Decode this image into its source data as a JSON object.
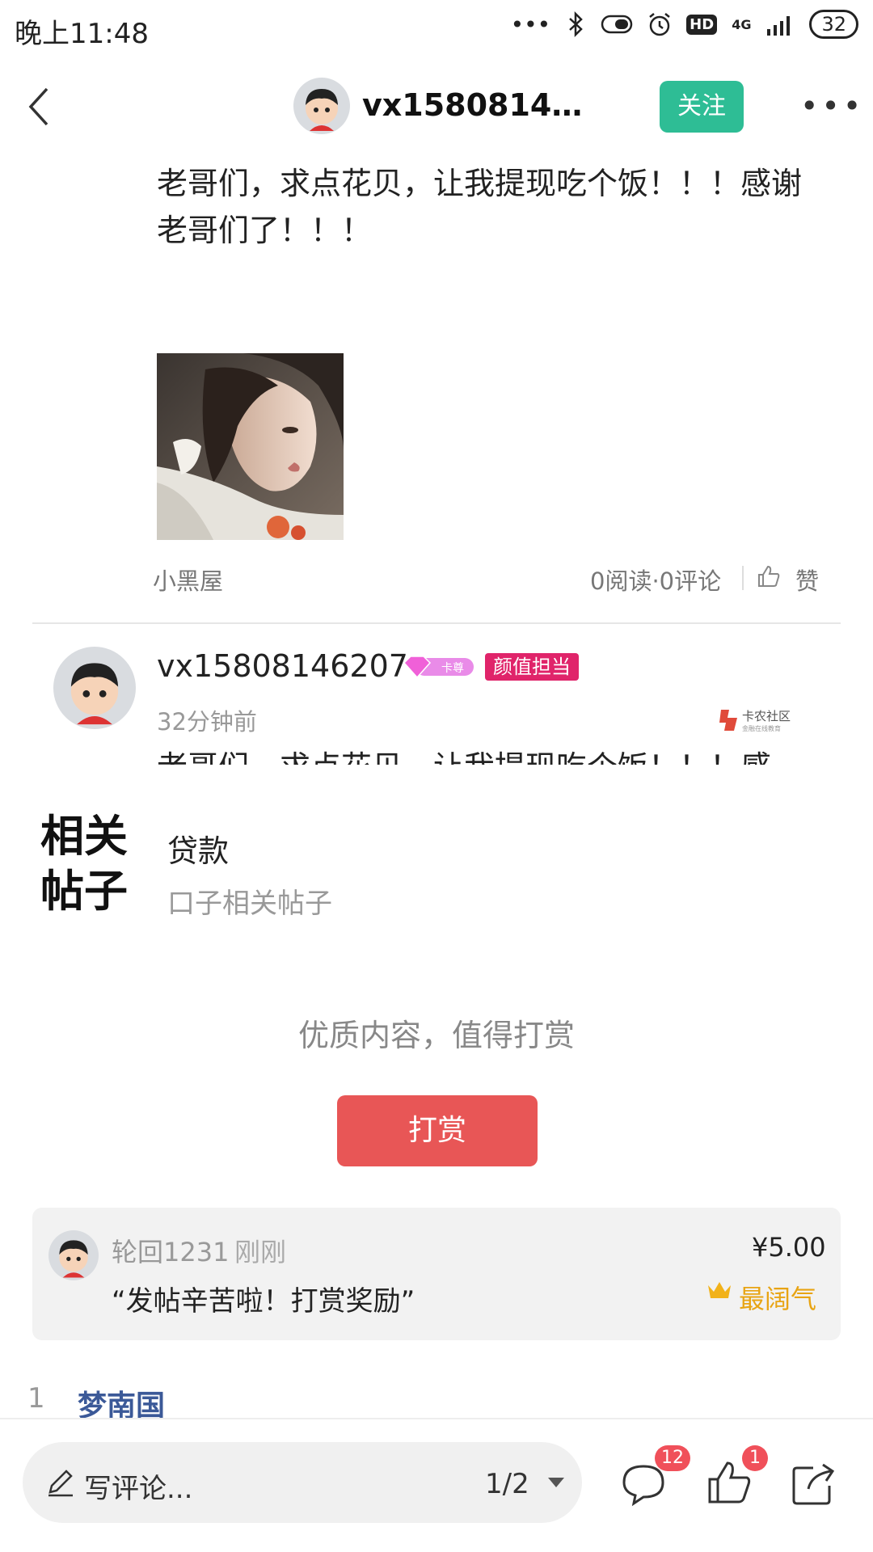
{
  "status_bar": {
    "time": "晚上11:48",
    "dots": "•••",
    "bluetooth": "bluetooth-icon",
    "alarm": "alarm-icon",
    "hd": "HD",
    "network": "4G",
    "battery": "32"
  },
  "header": {
    "username": "vx158081462...",
    "follow_label": "关注",
    "more_icon": "more-dots-icon"
  },
  "post": {
    "text": "老哥们，求点花贝，让我提现吃个饭！！！感谢老哥们了！！！",
    "section": "小黑屋",
    "stats": "0阅读·0评论",
    "like_label": "赞"
  },
  "author": {
    "username": "vx15808146207",
    "vip_badge": "卡尊",
    "tag": "颜值担当",
    "time": "32分钟前",
    "watermark": "卡农社区",
    "watermark_sub": "金融在线教育",
    "text_preview": "老哥们，求点花贝，让我提现吃个饭！！！感"
  },
  "related": {
    "title": "相关帖子",
    "heading": "贷款",
    "subtitle": "口子相关帖子"
  },
  "reward": {
    "prompt": "优质内容，值得打赏",
    "button_label": "打赏"
  },
  "reward_card": {
    "user": "轮回1231",
    "time": "刚刚",
    "message": "“发帖辛苦啦！打赏奖励”",
    "amount": "¥5.00",
    "title": "最阔气"
  },
  "floor": {
    "label": "1",
    "name": "梦南国"
  },
  "bottom_bar": {
    "comment_placeholder": "写评论...",
    "page": "1/2",
    "comment_count": "12",
    "like_count": "1"
  },
  "colors": {
    "follow": "#2ebd95",
    "reward_button": "#e85656",
    "tag": "#e0246a",
    "gold": "#e8a413",
    "badge": "#f0505a"
  }
}
